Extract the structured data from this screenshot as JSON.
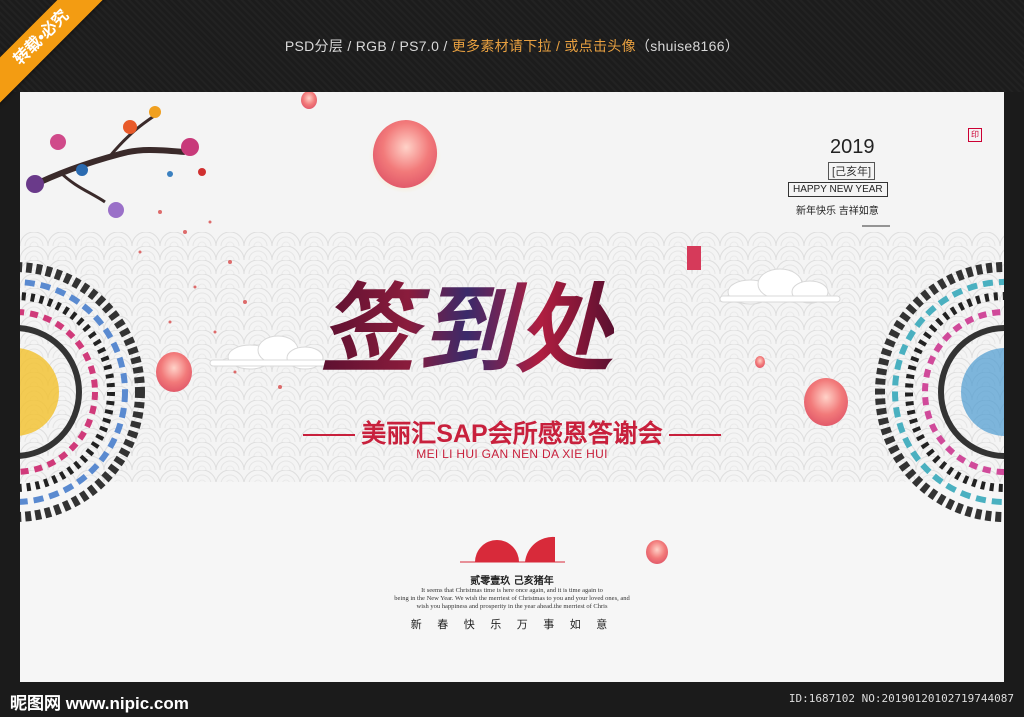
{
  "header": {
    "info_prefix": "PSD分层 / RGB / PS7.0 / ",
    "info_more": "更多素材请下拉 / 或点击头像",
    "info_suffix": "（shuise8166）"
  },
  "ribbon": {
    "label": "转载•必究"
  },
  "poster": {
    "year": "2019",
    "zodiac": "[己亥年]",
    "happy_new_year": "HAPPY NEW YEAR",
    "new_year_wish": "新年快乐 吉祥如意",
    "title": "签到处",
    "subtitle": "美丽汇SAP会所感恩答谢会",
    "pinyin": "MEI LI HUI GAN NEN DA XIE HUI",
    "small_cn": "贰零壹玖 己亥猪年",
    "small_en_lines": [
      "It seems that Christmas time is here once again, and it is time again to",
      "being in the New Year. We wish the merriest of Christmas to you and your loved ones, and",
      "wish you happiness and prosperity in the year ahead.the merriest of Chris"
    ],
    "blessing": "新 春 快 乐 万 事 如 意"
  },
  "footer": {
    "logo": "昵图网 www.nipic.com",
    "doc_id": "ID:1687102 NO:20190120102719744087"
  },
  "colors": {
    "accent": "#c8203c",
    "title": "#7b1330",
    "ribbon": "#f39c12",
    "lantern": "#f28a8a"
  }
}
